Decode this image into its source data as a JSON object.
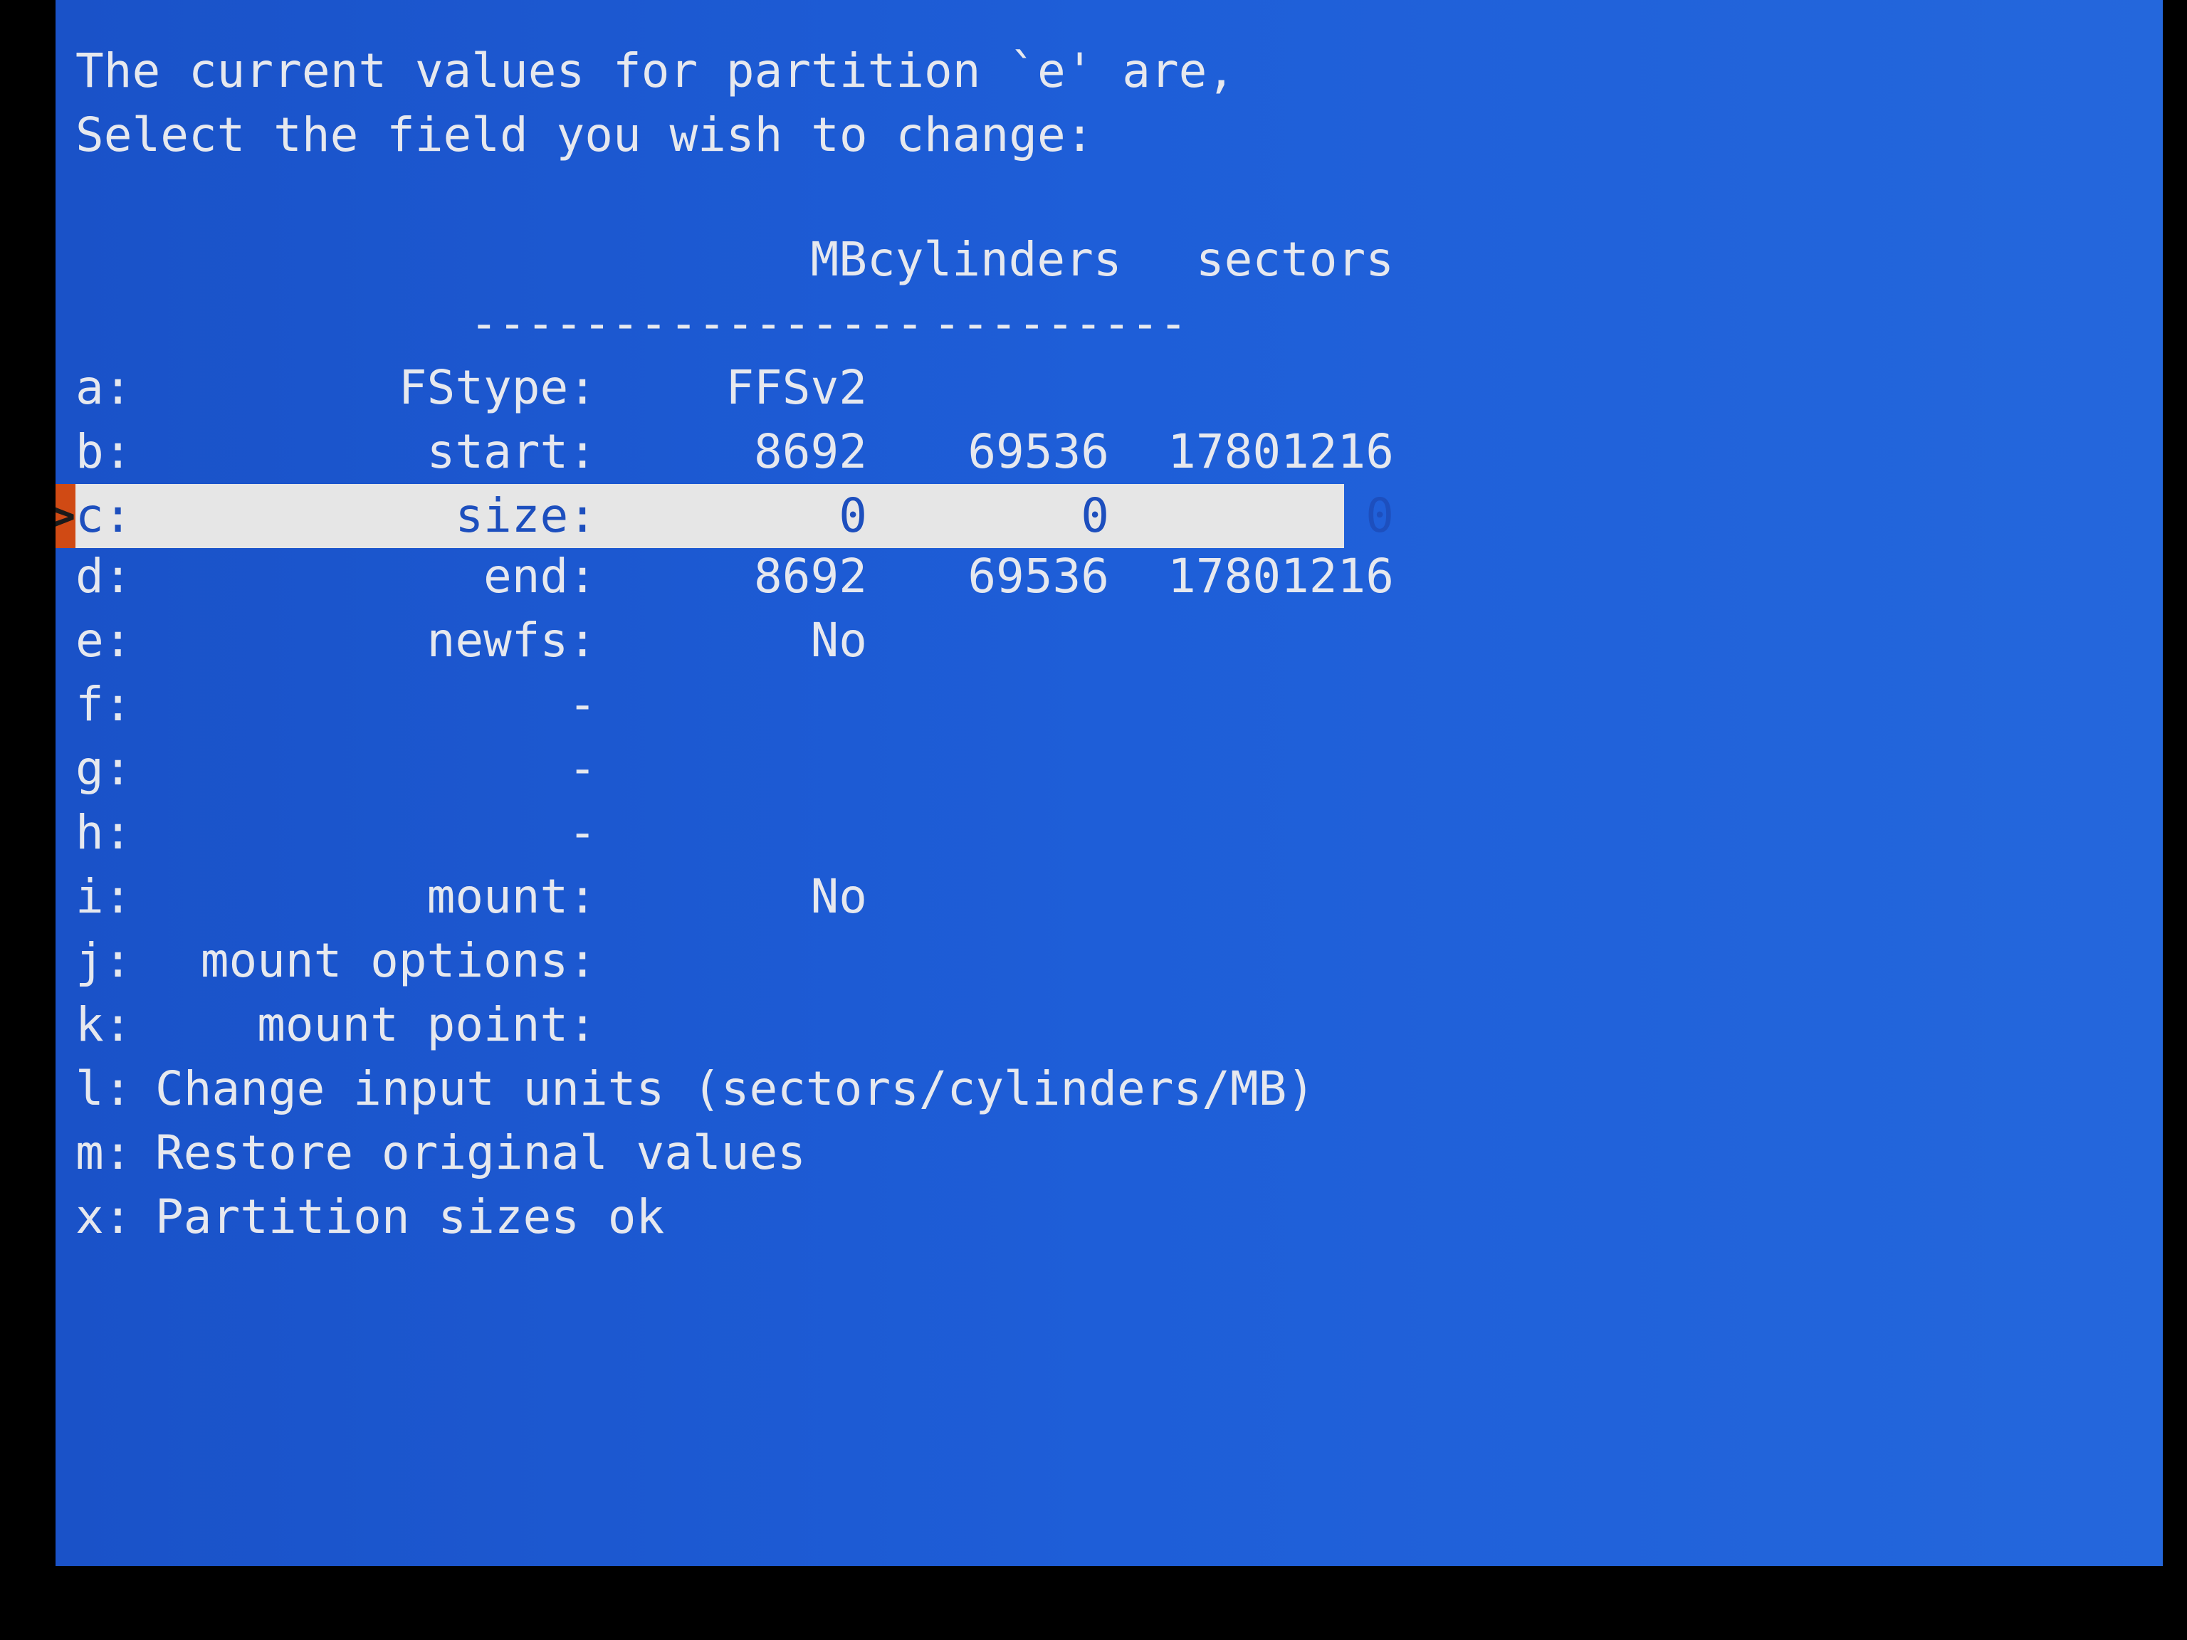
{
  "header": {
    "line1": "The current values for partition `e' are,",
    "line2": "Select the field you wish to change:"
  },
  "columns": {
    "mb": "MB",
    "cylinders": "cylinders",
    "sectors": "sectors",
    "mb_rule": "-------",
    "cyl_rule": "---------",
    "sec_rule": "---------"
  },
  "rows": [
    {
      "key": "a:",
      "label": "FStype:",
      "mb": "FFSv2",
      "cyl": "",
      "sec": ""
    },
    {
      "key": "b:",
      "label": "start:",
      "mb": "8692",
      "cyl": "69536",
      "sec": "17801216"
    },
    {
      "key": "c:",
      "label": "size:",
      "mb": "0",
      "cyl": "0",
      "sec": "0"
    },
    {
      "key": "d:",
      "label": "end:",
      "mb": "8692",
      "cyl": "69536",
      "sec": "17801216"
    },
    {
      "key": "e:",
      "label": "newfs:",
      "mb": "No",
      "cyl": "",
      "sec": ""
    },
    {
      "key": "f:",
      "label": "-",
      "mb": "",
      "cyl": "",
      "sec": ""
    },
    {
      "key": "g:",
      "label": "-",
      "mb": "",
      "cyl": "",
      "sec": ""
    },
    {
      "key": "h:",
      "label": "-",
      "mb": "",
      "cyl": "",
      "sec": ""
    },
    {
      "key": "i:",
      "label": "mount:",
      "mb": "No",
      "cyl": "",
      "sec": ""
    },
    {
      "key": "j:",
      "label": "mount options:",
      "mb": "",
      "cyl": "",
      "sec": ""
    },
    {
      "key": "k:",
      "label": "mount point:",
      "mb": "",
      "cyl": "",
      "sec": ""
    }
  ],
  "menu": [
    {
      "key": "l:",
      "label": "Change input units (sectors/cylinders/MB)"
    },
    {
      "key": "m:",
      "label": "Restore original values"
    },
    {
      "key": "x:",
      "label": "Partition sizes ok"
    }
  ],
  "selected_row": "c:",
  "cursor_glyph": ">",
  "colors": {
    "background": "#1e5ed8",
    "text": "#e6e8ee",
    "highlight": "#e6e6e6",
    "highlight_text": "#1d4fbe",
    "cursor": "#d04a14"
  }
}
